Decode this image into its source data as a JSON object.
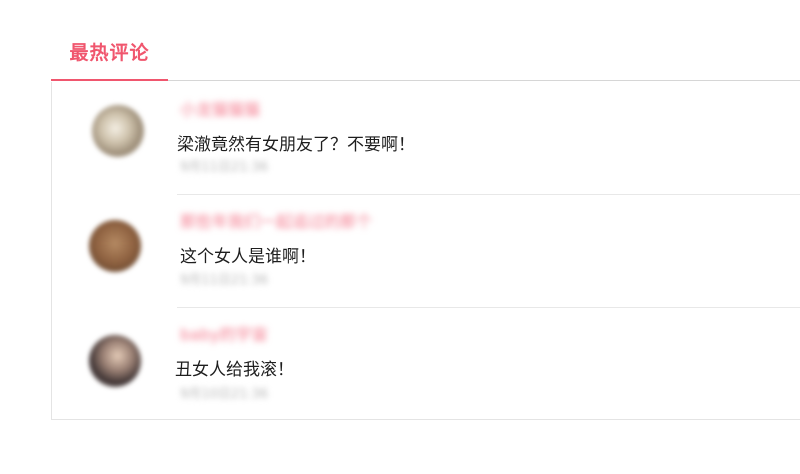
{
  "tabs": {
    "active_label": "最热评论"
  },
  "comments": [
    {
      "username": "小龙猫猫猫",
      "text": "梁澈竟然有女朋友了？不要啊！",
      "time": "9月11日21:36"
    },
    {
      "username": "那些年我们一起追过的那个",
      "text": "这个女人是谁啊！",
      "time": "9月11日21:36"
    },
    {
      "username": "baby的宇宙",
      "text": "丑女人给我滚！",
      "time": "9月10日21:36"
    }
  ],
  "colors": {
    "accent": "#f0566e",
    "username": "#f47a8d",
    "text": "#1e1e1e",
    "muted": "#b8b8b8",
    "divider": "#e8e8e8"
  }
}
